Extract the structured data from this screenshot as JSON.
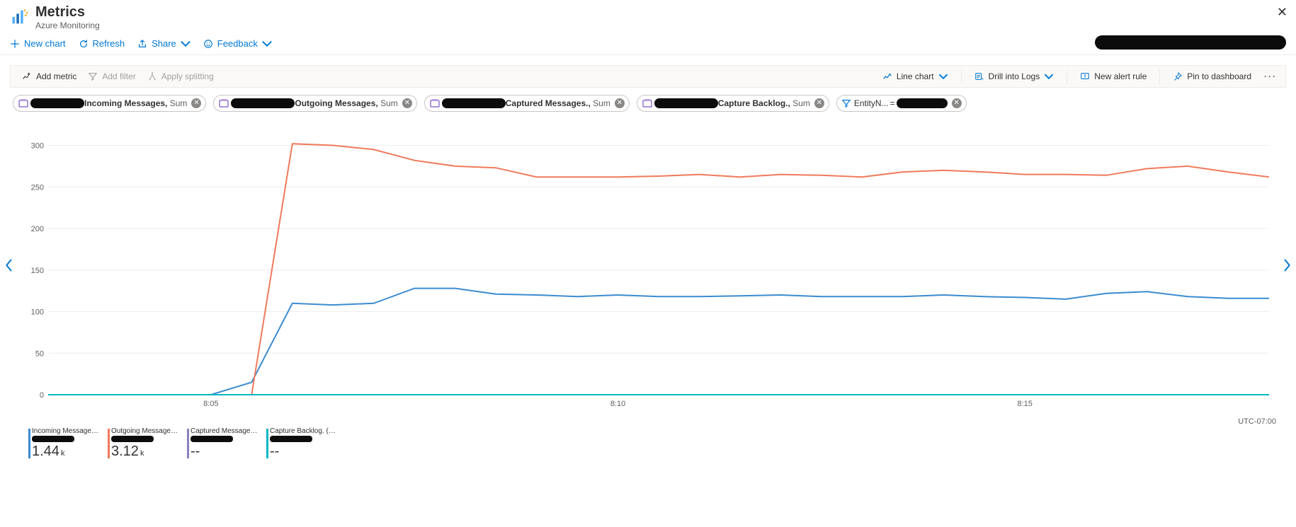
{
  "header": {
    "title": "Metrics",
    "subtitle": "Azure Monitoring"
  },
  "commandbar": {
    "new_chart": "New chart",
    "refresh": "Refresh",
    "share": "Share",
    "feedback": "Feedback"
  },
  "chart_toolbar": {
    "add_metric": "Add metric",
    "add_filter": "Add filter",
    "apply_splitting": "Apply splitting",
    "line_chart": "Line chart",
    "drill_logs": "Drill into Logs",
    "new_alert_rule": "New alert rule",
    "pin_dashboard": "Pin to dashboard"
  },
  "chips": [
    {
      "metric": "Incoming Messages",
      "agg": "Sum",
      "redactW": 76
    },
    {
      "metric": "Outgoing Messages",
      "agg": "Sum",
      "redactW": 90
    },
    {
      "metric": "Captured Messages.",
      "agg": "Sum",
      "redactW": 90
    },
    {
      "metric": "Capture Backlog.",
      "agg": "Sum",
      "redactW": 90
    }
  ],
  "filter_chip": {
    "prop": "EntityN...",
    "redactW": 72
  },
  "axes": {
    "y_ticks": [
      0,
      50,
      100,
      150,
      200,
      250,
      300
    ],
    "x_ticks": [
      "8:05",
      "8:10",
      "8:15"
    ],
    "tz": "UTC-07:00"
  },
  "legend": [
    {
      "name": "Incoming Messages (Sum)",
      "value": "1.44",
      "unit": "k",
      "color": "#3b8bd0"
    },
    {
      "name": "Outgoing Messages (Sum)",
      "value": "3.12",
      "unit": "k",
      "color": "#f07a5b"
    },
    {
      "name": "Captured Messages. (...",
      "value": "--",
      "unit": "",
      "color": "#8a7fbf"
    },
    {
      "name": "Capture Backlog. (Sum)",
      "value": "--",
      "unit": "",
      "color": "#00b7c3"
    }
  ],
  "chart_data": {
    "type": "line",
    "xlabel": "",
    "ylabel": "",
    "ylim": [
      0,
      320
    ],
    "x": [
      "8:03:00",
      "8:03:30",
      "8:04:00",
      "8:04:30",
      "8:05:00",
      "8:05:30",
      "8:06:00",
      "8:06:30",
      "8:07:00",
      "8:07:30",
      "8:08:00",
      "8:08:30",
      "8:09:00",
      "8:09:30",
      "8:10:00",
      "8:10:30",
      "8:11:00",
      "8:11:30",
      "8:12:00",
      "8:12:30",
      "8:13:00",
      "8:13:30",
      "8:14:00",
      "8:14:30",
      "8:15:00",
      "8:15:30",
      "8:16:00",
      "8:16:30",
      "8:17:00",
      "8:17:30",
      "8:18:00"
    ],
    "series": [
      {
        "name": "Incoming Messages (Sum)",
        "color": "#3b8bd0",
        "values": [
          0,
          0,
          0,
          0,
          0,
          15,
          110,
          108,
          110,
          128,
          128,
          121,
          120,
          118,
          120,
          118,
          118,
          119,
          120,
          118,
          118,
          118,
          120,
          118,
          117,
          115,
          122,
          124,
          118,
          116,
          116
        ]
      },
      {
        "name": "Outgoing Messages (Sum)",
        "color": "#f07a5b",
        "values": [
          0,
          0,
          0,
          0,
          0,
          0,
          302,
          300,
          295,
          282,
          275,
          273,
          262,
          262,
          262,
          263,
          265,
          262,
          265,
          264,
          262,
          268,
          270,
          268,
          265,
          265,
          264,
          272,
          275,
          268,
          262
        ]
      },
      {
        "name": "Captured Messages. (Sum)",
        "color": "#8a7fbf",
        "values": [
          0,
          0,
          0,
          0,
          0,
          0,
          0,
          0,
          0,
          0,
          0,
          0,
          0,
          0,
          0,
          0,
          0,
          0,
          0,
          0,
          0,
          0,
          0,
          0,
          0,
          0,
          0,
          0,
          0,
          0,
          0
        ]
      },
      {
        "name": "Capture Backlog. (Sum)",
        "color": "#00b7c3",
        "values": [
          0,
          0,
          0,
          0,
          0,
          0,
          0,
          0,
          0,
          0,
          0,
          0,
          0,
          0,
          0,
          0,
          0,
          0,
          0,
          0,
          0,
          0,
          0,
          0,
          0,
          0,
          0,
          0,
          0,
          0,
          0
        ]
      }
    ]
  }
}
